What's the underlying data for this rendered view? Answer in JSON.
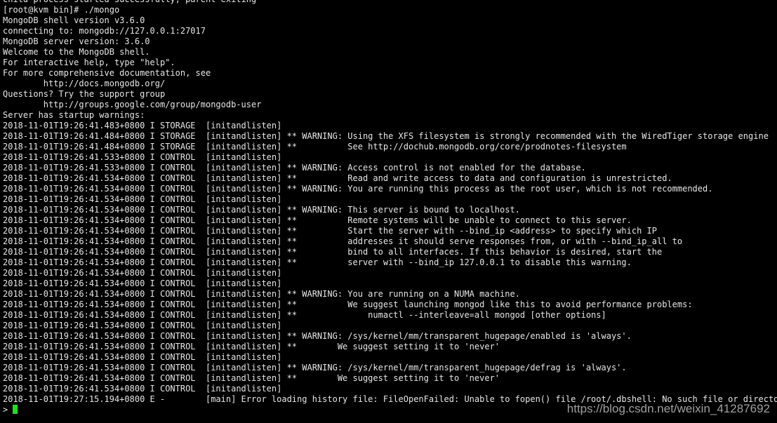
{
  "terminal": {
    "lines": [
      "child process started successfully, parent exiting",
      "[root@kvm bin]# ./mongo",
      "MongoDB shell version v3.6.0",
      "connecting to: mongodb://127.0.0.1:27017",
      "MongoDB server version: 3.6.0",
      "Welcome to the MongoDB shell.",
      "For interactive help, type \"help\".",
      "For more comprehensive documentation, see",
      "        http://docs.mongodb.org/",
      "Questions? Try the support group",
      "        http://groups.google.com/group/mongodb-user",
      "Server has startup warnings:",
      "2018-11-01T19:26:41.483+0800 I STORAGE  [initandlisten]",
      "2018-11-01T19:26:41.484+0800 I STORAGE  [initandlisten] ** WARNING: Using the XFS filesystem is strongly recommended with the WiredTiger storage engine",
      "2018-11-01T19:26:41.484+0800 I STORAGE  [initandlisten] **          See http://dochub.mongodb.org/core/prodnotes-filesystem",
      "2018-11-01T19:26:41.533+0800 I CONTROL  [initandlisten]",
      "2018-11-01T19:26:41.533+0800 I CONTROL  [initandlisten] ** WARNING: Access control is not enabled for the database.",
      "2018-11-01T19:26:41.534+0800 I CONTROL  [initandlisten] **          Read and write access to data and configuration is unrestricted.",
      "2018-11-01T19:26:41.534+0800 I CONTROL  [initandlisten] ** WARNING: You are running this process as the root user, which is not recommended.",
      "2018-11-01T19:26:41.534+0800 I CONTROL  [initandlisten]",
      "2018-11-01T19:26:41.534+0800 I CONTROL  [initandlisten] ** WARNING: This server is bound to localhost.",
      "2018-11-01T19:26:41.534+0800 I CONTROL  [initandlisten] **          Remote systems will be unable to connect to this server.",
      "2018-11-01T19:26:41.534+0800 I CONTROL  [initandlisten] **          Start the server with --bind_ip <address> to specify which IP",
      "2018-11-01T19:26:41.534+0800 I CONTROL  [initandlisten] **          addresses it should serve responses from, or with --bind_ip_all to",
      "2018-11-01T19:26:41.534+0800 I CONTROL  [initandlisten] **          bind to all interfaces. If this behavior is desired, start the",
      "2018-11-01T19:26:41.534+0800 I CONTROL  [initandlisten] **          server with --bind_ip 127.0.0.1 to disable this warning.",
      "2018-11-01T19:26:41.534+0800 I CONTROL  [initandlisten]",
      "2018-11-01T19:26:41.534+0800 I CONTROL  [initandlisten]",
      "2018-11-01T19:26:41.534+0800 I CONTROL  [initandlisten] ** WARNING: You are running on a NUMA machine.",
      "2018-11-01T19:26:41.534+0800 I CONTROL  [initandlisten] **          We suggest launching mongod like this to avoid performance problems:",
      "2018-11-01T19:26:41.534+0800 I CONTROL  [initandlisten] **              numactl --interleave=all mongod [other options]",
      "2018-11-01T19:26:41.534+0800 I CONTROL  [initandlisten]",
      "2018-11-01T19:26:41.534+0800 I CONTROL  [initandlisten] ** WARNING: /sys/kernel/mm/transparent_hugepage/enabled is 'always'.",
      "2018-11-01T19:26:41.534+0800 I CONTROL  [initandlisten] **        We suggest setting it to 'never'",
      "2018-11-01T19:26:41.534+0800 I CONTROL  [initandlisten]",
      "2018-11-01T19:26:41.534+0800 I CONTROL  [initandlisten] ** WARNING: /sys/kernel/mm/transparent_hugepage/defrag is 'always'.",
      "2018-11-01T19:26:41.534+0800 I CONTROL  [initandlisten] **        We suggest setting it to 'never'",
      "2018-11-01T19:26:41.534+0800 I CONTROL  [initandlisten]",
      "2018-11-01T19:27:15.194+0800 E -        [main] Error loading history file: FileOpenFailed: Unable to fopen() file /root/.dbshell: No such file or directory"
    ],
    "prompt": ">",
    "cursor_color": "#1fe01f"
  },
  "watermark": {
    "text": "https://blog.csdn.net/weixin_41287692"
  }
}
